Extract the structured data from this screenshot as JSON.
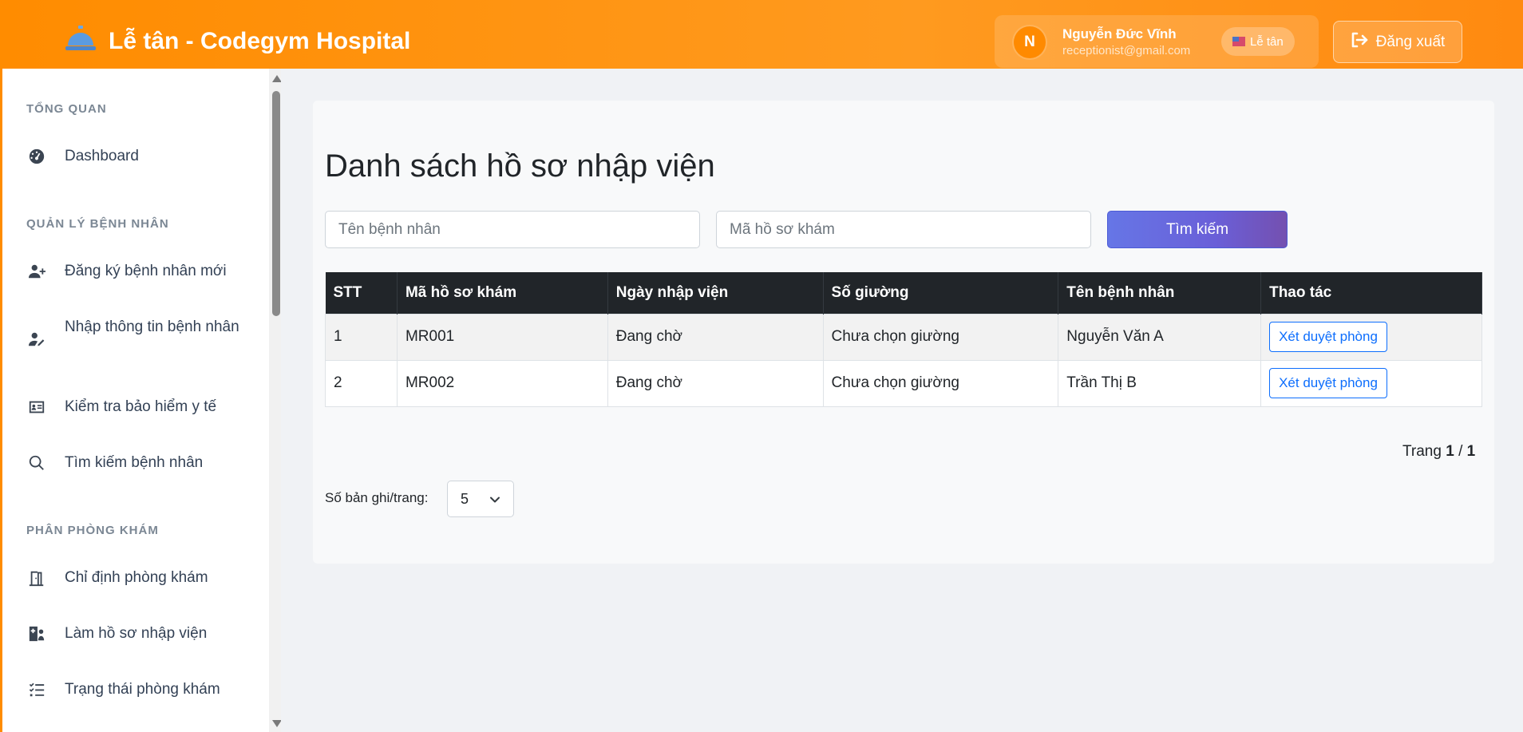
{
  "header": {
    "title": "Lễ tân - Codegym Hospital",
    "user_initial": "N",
    "user_name": "Nguyễn Đức Vĩnh",
    "user_email": "receptionist@gmail.com",
    "role_badge": "Lễ tân",
    "logout_label": "Đăng xuất",
    "brand_icon": "concierge-bell-icon",
    "accent_color": "#ff8c00"
  },
  "sidebar": {
    "sections": [
      {
        "label": "TỔNG QUAN",
        "items": [
          {
            "label": "Dashboard",
            "icon": "dashboard-gauge-icon"
          }
        ]
      },
      {
        "label": "QUẢN LÝ BỆNH NHÂN",
        "items": [
          {
            "label": "Đăng ký bệnh nhân mới",
            "icon": "user-plus-icon"
          },
          {
            "label": "Nhập thông tin bệnh nhân",
            "icon": "user-edit-icon"
          },
          {
            "label": "Kiểm tra bảo hiểm y tế",
            "icon": "id-card-icon"
          },
          {
            "label": "Tìm kiếm bệnh nhân",
            "icon": "search-icon"
          }
        ]
      },
      {
        "label": "PHÂN PHÒNG KHÁM",
        "items": [
          {
            "label": "Chỉ định phòng khám",
            "icon": "door-icon"
          },
          {
            "label": "Làm hồ sơ nhập viện",
            "icon": "hospital-user-icon"
          },
          {
            "label": "Trạng thái phòng khám",
            "icon": "list-check-icon"
          }
        ]
      }
    ]
  },
  "main": {
    "title": "Danh sách hồ sơ nhập viện",
    "search": {
      "patient_name_placeholder": "Tên bệnh nhân",
      "record_code_placeholder": "Mã hồ sơ khám",
      "button_label": "Tìm kiếm"
    },
    "table": {
      "headers": [
        "STT",
        "Mã hồ sơ khám",
        "Ngày nhập viện",
        "Số giường",
        "Tên bệnh nhân",
        "Thao tác"
      ],
      "rows": [
        {
          "stt": "1",
          "code": "MR001",
          "admit_date": "Đang chờ",
          "bed": "Chưa chọn giường",
          "patient": "Nguyễn Văn A",
          "action": "Xét duyệt phòng"
        },
        {
          "stt": "2",
          "code": "MR002",
          "admit_date": "Đang chờ",
          "bed": "Chưa chọn giường",
          "patient": "Trần Thị B",
          "action": "Xét duyệt phòng"
        }
      ]
    },
    "pagination": {
      "prefix": "Trang",
      "current": "1",
      "separator": "/",
      "total": "1"
    },
    "per_page": {
      "label": "Số bản ghi/trang:",
      "value": "5"
    }
  }
}
